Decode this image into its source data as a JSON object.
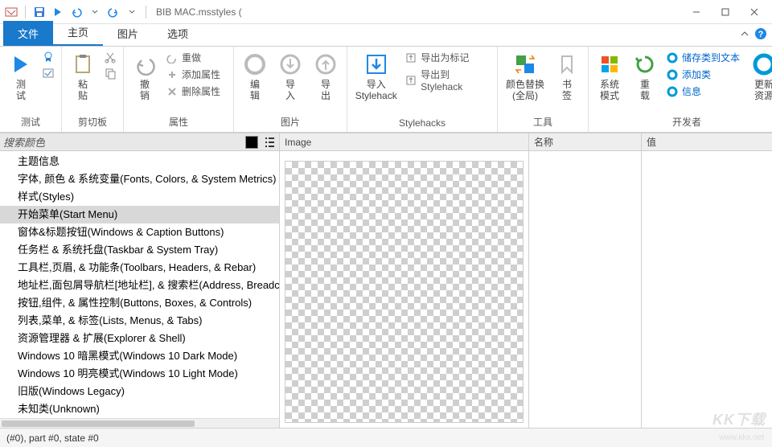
{
  "window": {
    "title": "BIB MAC.msstyles ("
  },
  "tabs": {
    "file": "文件",
    "home": "主页",
    "image": "图片",
    "options": "选项"
  },
  "ribbon": {
    "test_group": "测试",
    "test_btn": "测\n试",
    "clipboard_group": "剪切板",
    "paste_btn": "粘\n贴",
    "attr_group": "属性",
    "undo_btn": "撤\n销",
    "redo_label": "重做",
    "addattr_label": "添加属性",
    "delattr_label": "删除属性",
    "image_group": "图片",
    "edit_btn": "编\n辑",
    "import_btn": "导\n入",
    "export_btn": "导\n出",
    "stylehacks_group": "Stylehacks",
    "import_sh": "导入\nStylehack",
    "export_bookmark": "导出为标记",
    "export_sh": "导出到Stylehack",
    "tools_group": "工具",
    "color_replace": "颜色替换\n(全局)",
    "bookmark": "书\n签",
    "dev_group": "开发者",
    "sysmode": "系统\n模式",
    "reload": "重\n载",
    "save_class_text": "储存类到文本",
    "add_class": "添加类",
    "info": "信息",
    "update_res": "更新\n资源"
  },
  "search": {
    "placeholder": "搜索颜色"
  },
  "tree": [
    "主题信息",
    "字体, 颜色 & 系统变量(Fonts, Colors, & System Metrics)",
    "样式(Styles)",
    "开始菜单(Start Menu)",
    "窗体&标题按钮(Windows & Caption Buttons)",
    "任务栏 & 系统托盘(Taskbar & System Tray)",
    "工具栏,页眉, & 功能条(Toolbars, Headers, & Rebar)",
    "地址栏,面包屑导航栏[地址栏], & 搜索栏(Address, Breadcrumbs, & Search)",
    "按钮,组件, & 属性控制(Buttons, Boxes, & Controls)",
    "列表,菜单, & 标签(Lists, Menus, & Tabs)",
    "资源管理器 & 扩展(Explorer & Shell)",
    "Windows 10 暗黑模式(Windows 10 Dark Mode)",
    "Windows 10 明亮模式(Windows 10 Light Mode)",
    "旧版(Windows Legacy)",
    "未知类(Unknown)"
  ],
  "tree_selected_index": 3,
  "columns": {
    "image": "Image",
    "name": "名称",
    "value": "值"
  },
  "statusbar": "(#0),  part #0,  state #0",
  "watermark": "KK下载",
  "watermark_sub": "www.kkx.net"
}
